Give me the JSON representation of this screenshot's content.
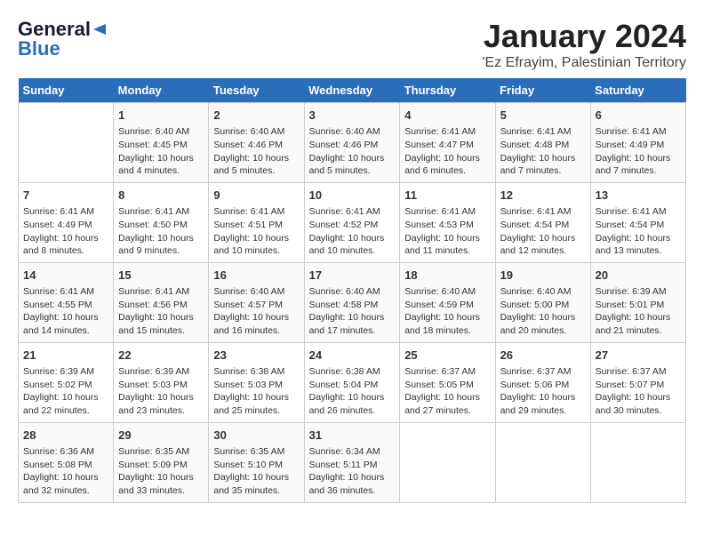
{
  "logo": {
    "line1": "General",
    "line2": "Blue"
  },
  "title": "January 2024",
  "subtitle": "'Ez Efrayim, Palestinian Territory",
  "days_of_week": [
    "Sunday",
    "Monday",
    "Tuesday",
    "Wednesday",
    "Thursday",
    "Friday",
    "Saturday"
  ],
  "weeks": [
    [
      {
        "day": "",
        "info": ""
      },
      {
        "day": "1",
        "info": "Sunrise: 6:40 AM\nSunset: 4:45 PM\nDaylight: 10 hours\nand 4 minutes."
      },
      {
        "day": "2",
        "info": "Sunrise: 6:40 AM\nSunset: 4:46 PM\nDaylight: 10 hours\nand 5 minutes."
      },
      {
        "day": "3",
        "info": "Sunrise: 6:40 AM\nSunset: 4:46 PM\nDaylight: 10 hours\nand 5 minutes."
      },
      {
        "day": "4",
        "info": "Sunrise: 6:41 AM\nSunset: 4:47 PM\nDaylight: 10 hours\nand 6 minutes."
      },
      {
        "day": "5",
        "info": "Sunrise: 6:41 AM\nSunset: 4:48 PM\nDaylight: 10 hours\nand 7 minutes."
      },
      {
        "day": "6",
        "info": "Sunrise: 6:41 AM\nSunset: 4:49 PM\nDaylight: 10 hours\nand 7 minutes."
      }
    ],
    [
      {
        "day": "7",
        "info": "Sunrise: 6:41 AM\nSunset: 4:49 PM\nDaylight: 10 hours\nand 8 minutes."
      },
      {
        "day": "8",
        "info": "Sunrise: 6:41 AM\nSunset: 4:50 PM\nDaylight: 10 hours\nand 9 minutes."
      },
      {
        "day": "9",
        "info": "Sunrise: 6:41 AM\nSunset: 4:51 PM\nDaylight: 10 hours\nand 10 minutes."
      },
      {
        "day": "10",
        "info": "Sunrise: 6:41 AM\nSunset: 4:52 PM\nDaylight: 10 hours\nand 10 minutes."
      },
      {
        "day": "11",
        "info": "Sunrise: 6:41 AM\nSunset: 4:53 PM\nDaylight: 10 hours\nand 11 minutes."
      },
      {
        "day": "12",
        "info": "Sunrise: 6:41 AM\nSunset: 4:54 PM\nDaylight: 10 hours\nand 12 minutes."
      },
      {
        "day": "13",
        "info": "Sunrise: 6:41 AM\nSunset: 4:54 PM\nDaylight: 10 hours\nand 13 minutes."
      }
    ],
    [
      {
        "day": "14",
        "info": "Sunrise: 6:41 AM\nSunset: 4:55 PM\nDaylight: 10 hours\nand 14 minutes."
      },
      {
        "day": "15",
        "info": "Sunrise: 6:41 AM\nSunset: 4:56 PM\nDaylight: 10 hours\nand 15 minutes."
      },
      {
        "day": "16",
        "info": "Sunrise: 6:40 AM\nSunset: 4:57 PM\nDaylight: 10 hours\nand 16 minutes."
      },
      {
        "day": "17",
        "info": "Sunrise: 6:40 AM\nSunset: 4:58 PM\nDaylight: 10 hours\nand 17 minutes."
      },
      {
        "day": "18",
        "info": "Sunrise: 6:40 AM\nSunset: 4:59 PM\nDaylight: 10 hours\nand 18 minutes."
      },
      {
        "day": "19",
        "info": "Sunrise: 6:40 AM\nSunset: 5:00 PM\nDaylight: 10 hours\nand 20 minutes."
      },
      {
        "day": "20",
        "info": "Sunrise: 6:39 AM\nSunset: 5:01 PM\nDaylight: 10 hours\nand 21 minutes."
      }
    ],
    [
      {
        "day": "21",
        "info": "Sunrise: 6:39 AM\nSunset: 5:02 PM\nDaylight: 10 hours\nand 22 minutes."
      },
      {
        "day": "22",
        "info": "Sunrise: 6:39 AM\nSunset: 5:03 PM\nDaylight: 10 hours\nand 23 minutes."
      },
      {
        "day": "23",
        "info": "Sunrise: 6:38 AM\nSunset: 5:03 PM\nDaylight: 10 hours\nand 25 minutes."
      },
      {
        "day": "24",
        "info": "Sunrise: 6:38 AM\nSunset: 5:04 PM\nDaylight: 10 hours\nand 26 minutes."
      },
      {
        "day": "25",
        "info": "Sunrise: 6:37 AM\nSunset: 5:05 PM\nDaylight: 10 hours\nand 27 minutes."
      },
      {
        "day": "26",
        "info": "Sunrise: 6:37 AM\nSunset: 5:06 PM\nDaylight: 10 hours\nand 29 minutes."
      },
      {
        "day": "27",
        "info": "Sunrise: 6:37 AM\nSunset: 5:07 PM\nDaylight: 10 hours\nand 30 minutes."
      }
    ],
    [
      {
        "day": "28",
        "info": "Sunrise: 6:36 AM\nSunset: 5:08 PM\nDaylight: 10 hours\nand 32 minutes."
      },
      {
        "day": "29",
        "info": "Sunrise: 6:35 AM\nSunset: 5:09 PM\nDaylight: 10 hours\nand 33 minutes."
      },
      {
        "day": "30",
        "info": "Sunrise: 6:35 AM\nSunset: 5:10 PM\nDaylight: 10 hours\nand 35 minutes."
      },
      {
        "day": "31",
        "info": "Sunrise: 6:34 AM\nSunset: 5:11 PM\nDaylight: 10 hours\nand 36 minutes."
      },
      {
        "day": "",
        "info": ""
      },
      {
        "day": "",
        "info": ""
      },
      {
        "day": "",
        "info": ""
      }
    ]
  ]
}
